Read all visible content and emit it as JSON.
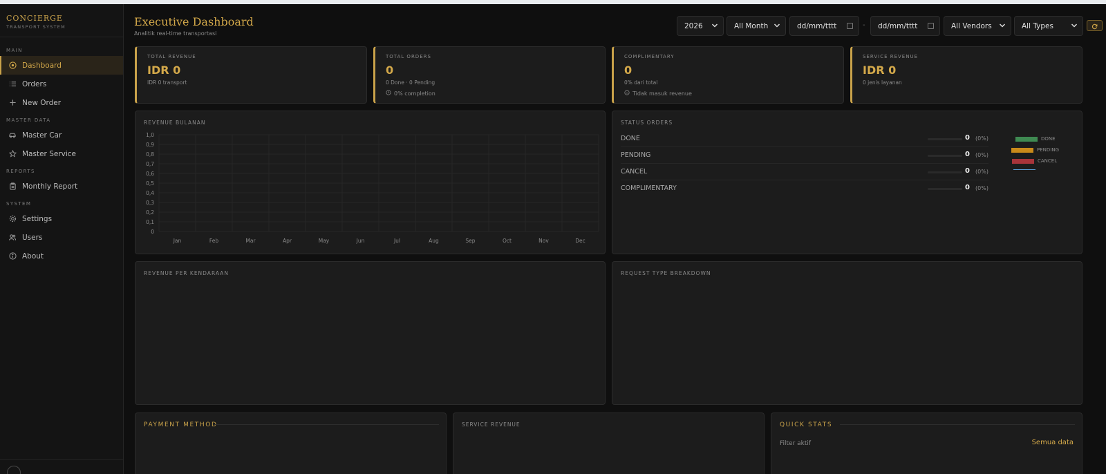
{
  "brand": {
    "title": "CONCIERGE",
    "subtitle": "TRANSPORT SYSTEM"
  },
  "sidebar": {
    "sections": [
      {
        "label": "MAIN",
        "items": [
          {
            "label": "Dashboard",
            "icon": "dashboard-icon",
            "active": true
          },
          {
            "label": "Orders",
            "icon": "list-icon"
          },
          {
            "label": "New Order",
            "icon": "plus-icon"
          }
        ]
      },
      {
        "label": "MASTER DATA",
        "items": [
          {
            "label": "Master Car",
            "icon": "car-icon"
          },
          {
            "label": "Master Service",
            "icon": "star-icon"
          }
        ]
      },
      {
        "label": "REPORTS",
        "items": [
          {
            "label": "Monthly Report",
            "icon": "clipboard-icon"
          }
        ]
      },
      {
        "label": "SYSTEM",
        "items": [
          {
            "label": "Settings",
            "icon": "gear-icon"
          },
          {
            "label": "Users",
            "icon": "users-icon"
          },
          {
            "label": "About",
            "icon": "info-icon"
          }
        ]
      }
    ]
  },
  "header": {
    "title": "Executive Dashboard",
    "subtitle": "Analitik real-time transportasi"
  },
  "filters": {
    "year": "2026",
    "month": "All Month",
    "date_from_placeholder": "dd/mm/tttt",
    "date_separator": "-",
    "date_to_placeholder": "dd/mm/tttt",
    "vendor": "All Vendors",
    "type": "All Types"
  },
  "kpis": [
    {
      "label": "TOTAL REVENUE",
      "value": "IDR 0",
      "sub": "IDR 0 transport"
    },
    {
      "label": "TOTAL ORDERS",
      "value": "0",
      "sub": "0 Done · 0 Pending",
      "sub2": "0% completion"
    },
    {
      "label": "COMPLIMENTARY",
      "value": "0",
      "sub": "0% dari total",
      "sub2": "Tidak masuk revenue"
    },
    {
      "label": "SERVICE REVENUE",
      "value": "IDR 0",
      "sub": "0 jenis layanan"
    }
  ],
  "panels": {
    "revenue_monthly": "REVENUE BULANAN",
    "status_orders": "STATUS ORDERS",
    "revenue_vehicle": "REVENUE PER KENDARAAN",
    "request_type": "REQUEST TYPE BREAKDOWN",
    "payment_method": "PAYMENT METHOD",
    "service_revenue": "SERVICE REVENUE",
    "quick_stats": "QUICK STATS"
  },
  "status_orders": [
    {
      "label": "DONE",
      "count": "0",
      "pct": "(0%)",
      "fraction": 0
    },
    {
      "label": "PENDING",
      "count": "0",
      "pct": "(0%)",
      "fraction": 0
    },
    {
      "label": "CANCEL",
      "count": "0",
      "pct": "(0%)",
      "fraction": 0
    },
    {
      "label": "COMPLIMENTARY",
      "count": "0",
      "pct": "(0%)",
      "fraction": 0
    }
  ],
  "status_legend": [
    {
      "label": "DONE",
      "color": "#3f8a52"
    },
    {
      "label": "PENDING",
      "color": "#c98a1a"
    },
    {
      "label": "CANCEL",
      "color": "#a8343a"
    }
  ],
  "quick_stats": {
    "filter_label": "Filter aktif",
    "filter_value": "Semua data"
  },
  "colors": {
    "accent": "#c9a24a",
    "background": "#0f0f0f",
    "panel": "#1c1c1c"
  },
  "chart_data": {
    "type": "bar",
    "title": "",
    "xlabel": "",
    "ylabel": "",
    "categories": [
      "Jan",
      "Feb",
      "Mar",
      "Apr",
      "May",
      "Jun",
      "Jul",
      "Aug",
      "Sep",
      "Oct",
      "Nov",
      "Dec"
    ],
    "values": [
      0,
      0,
      0,
      0,
      0,
      0,
      0,
      0,
      0,
      0,
      0,
      0
    ],
    "ylim": [
      0,
      1
    ],
    "yticks": [
      "1,0",
      "0,9",
      "0,8",
      "0,7",
      "0,6",
      "0,5",
      "0,4",
      "0,3",
      "0,2",
      "0,1",
      "0"
    ],
    "grid": true
  }
}
